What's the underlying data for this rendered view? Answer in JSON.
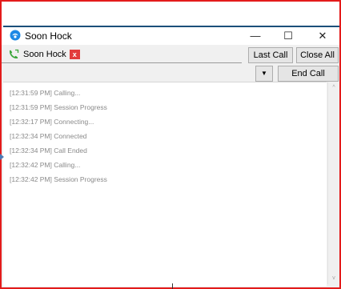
{
  "window": {
    "title": "Soon Hock",
    "minimize_glyph": "—",
    "maximize_glyph": "☐",
    "close_glyph": "✕"
  },
  "tab": {
    "contact_name": "Soon Hock",
    "close_glyph": "x"
  },
  "toolbar": {
    "last_call_label": "Last Call",
    "close_all_label": "Close All",
    "dropdown_glyph": "▼",
    "end_call_label": "End Call"
  },
  "log": [
    "[12:31:59 PM] Calling...",
    "[12:31:59 PM] Session Progress",
    "[12:32:17 PM] Connecting...",
    "[12:32:34 PM] Connected",
    "[12:32:34 PM] Call Ended",
    "[12:32:42 PM] Calling...",
    "[12:32:42 PM] Session Progress"
  ],
  "scrollbar": {
    "up_glyph": "^",
    "down_glyph": "v"
  },
  "colors": {
    "frame_border": "#e31b1b",
    "accent_blue": "#1b4f7a",
    "tab_close": "#e23c3c",
    "phone_green": "#3aa53a",
    "log_text": "#8a8a8a"
  }
}
